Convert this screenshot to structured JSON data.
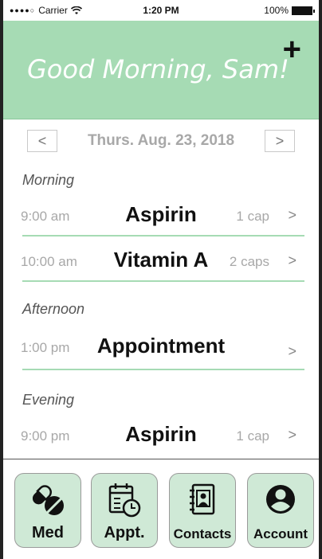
{
  "status_bar": {
    "carrier": "Carrier",
    "time": "1:20 PM",
    "battery": "100%"
  },
  "header": {
    "greeting": "Good Morning, Sam!",
    "add_icon": "plus-icon"
  },
  "date_nav": {
    "prev_label": "<",
    "date": "Thurs. Aug. 23, 2018",
    "next_label": ">"
  },
  "schedule": {
    "morning": {
      "label": "Morning",
      "items": [
        {
          "time": "9:00 am",
          "name": "Aspirin",
          "dose": "1 cap"
        },
        {
          "time": "10:00 am",
          "name": "Vitamin A",
          "dose": "2 caps"
        }
      ]
    },
    "afternoon": {
      "label": "Afternoon",
      "items": [
        {
          "time": "1:00 pm",
          "name": "Appointment",
          "dose": ""
        }
      ]
    },
    "evening": {
      "label": "Evening",
      "items": [
        {
          "time": "9:00 pm",
          "name": "Aspirin",
          "dose": "1 cap"
        }
      ]
    }
  },
  "tabs": [
    {
      "label": "Med",
      "icon": "pills-icon"
    },
    {
      "label": "Appt.",
      "icon": "calendar-clock-icon"
    },
    {
      "label": "Contacts",
      "icon": "contact-book-icon"
    },
    {
      "label": "Account",
      "icon": "user-circle-icon"
    }
  ],
  "colors": {
    "accent": "#a6dbb4",
    "tab_bg": "#cfe9d6",
    "muted_text": "#a8a8a8"
  }
}
